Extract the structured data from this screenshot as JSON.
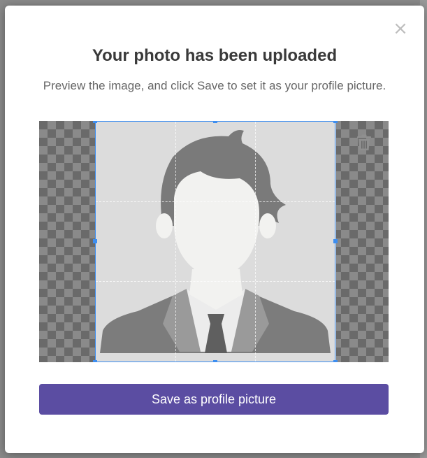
{
  "modal": {
    "close_glyph": "×",
    "title": "Your photo has been uploaded",
    "subtitle": "Preview the image, and click Save to set it as your profile picture.",
    "save_label": "Save as profile picture"
  },
  "colors": {
    "primary_button": "#5b4da2",
    "crop_border": "#3d8ef0"
  },
  "icons": {
    "close": "close-icon",
    "trash": "trash-icon",
    "avatar": "default-avatar-placeholder"
  }
}
